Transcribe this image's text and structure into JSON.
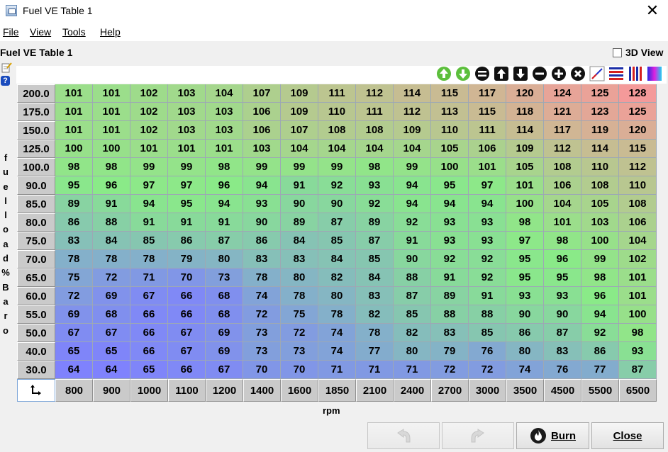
{
  "window": {
    "title": "Fuel VE Table 1",
    "icon": "app-icon",
    "close_glyph": "✕"
  },
  "menu": [
    "File",
    "View",
    "Tools",
    "Help"
  ],
  "panel": {
    "title": "Fuel VE Table 1",
    "view3d_label": "3D View",
    "view3d_checked": false
  },
  "toolbar_icons": [
    "increment-green-icon",
    "decrement-green-icon",
    "set-value-icon",
    "increase-icon",
    "decrease-icon",
    "subtract-icon",
    "add-icon",
    "multiply-icon",
    "interpolate-icon",
    "smooth-horizontal-icon",
    "smooth-vertical-icon",
    "color-scale-icon"
  ],
  "y_axis_label": "fuel load % Baro",
  "x_axis_label": "rpm",
  "load_values": [
    "200.0",
    "175.0",
    "150.0",
    "125.0",
    "100.0",
    "90.0",
    "85.0",
    "80.0",
    "75.0",
    "70.0",
    "65.0",
    "60.0",
    "55.0",
    "50.0",
    "40.0",
    "30.0"
  ],
  "rpm_values": [
    "800",
    "900",
    "1000",
    "1100",
    "1200",
    "1400",
    "1600",
    "1850",
    "2100",
    "2400",
    "2700",
    "3000",
    "3500",
    "4500",
    "5500",
    "6500"
  ],
  "ve_table": [
    [
      101,
      101,
      102,
      103,
      104,
      107,
      109,
      111,
      112,
      114,
      115,
      117,
      120,
      124,
      125,
      128
    ],
    [
      101,
      101,
      102,
      103,
      103,
      106,
      109,
      110,
      111,
      112,
      113,
      115,
      118,
      121,
      123,
      125
    ],
    [
      101,
      101,
      102,
      103,
      103,
      106,
      107,
      108,
      108,
      109,
      110,
      111,
      114,
      117,
      119,
      120
    ],
    [
      100,
      100,
      101,
      101,
      101,
      103,
      104,
      104,
      104,
      104,
      105,
      106,
      109,
      112,
      114,
      115
    ],
    [
      98,
      98,
      99,
      99,
      98,
      99,
      99,
      99,
      98,
      99,
      100,
      101,
      105,
      108,
      110,
      112
    ],
    [
      95,
      96,
      97,
      97,
      96,
      94,
      91,
      92,
      93,
      94,
      95,
      97,
      101,
      106,
      108,
      110
    ],
    [
      89,
      91,
      94,
      95,
      94,
      93,
      90,
      90,
      92,
      94,
      94,
      94,
      100,
      104,
      105,
      108
    ],
    [
      86,
      88,
      91,
      91,
      91,
      90,
      89,
      87,
      89,
      92,
      93,
      93,
      98,
      101,
      103,
      106
    ],
    [
      83,
      84,
      85,
      86,
      87,
      86,
      84,
      85,
      87,
      91,
      93,
      93,
      97,
      98,
      100,
      104
    ],
    [
      78,
      78,
      78,
      79,
      80,
      83,
      83,
      84,
      85,
      90,
      92,
      92,
      95,
      96,
      99,
      102
    ],
    [
      75,
      72,
      71,
      70,
      73,
      78,
      80,
      82,
      84,
      88,
      91,
      92,
      95,
      95,
      98,
      101
    ],
    [
      72,
      69,
      67,
      66,
      68,
      74,
      78,
      80,
      83,
      87,
      89,
      91,
      93,
      93,
      96,
      101
    ],
    [
      69,
      68,
      66,
      66,
      68,
      72,
      75,
      78,
      82,
      85,
      88,
      88,
      90,
      90,
      94,
      100
    ],
    [
      67,
      67,
      66,
      67,
      69,
      73,
      72,
      74,
      78,
      82,
      83,
      85,
      86,
      87,
      92,
      98
    ],
    [
      65,
      65,
      66,
      67,
      69,
      73,
      73,
      74,
      77,
      80,
      79,
      76,
      80,
      83,
      86,
      93
    ],
    [
      64,
      64,
      65,
      66,
      67,
      70,
      70,
      71,
      71,
      71,
      72,
      72,
      74,
      76,
      77,
      87
    ]
  ],
  "colors": {
    "low": "#7f82fd",
    "mid": "#8aea88",
    "high": "#f49a9a"
  },
  "buttons": {
    "undo_icon": "undo-icon",
    "redo_icon": "redo-icon",
    "burn": "Burn",
    "burn_icon": "burn-icon",
    "close": "Close"
  }
}
